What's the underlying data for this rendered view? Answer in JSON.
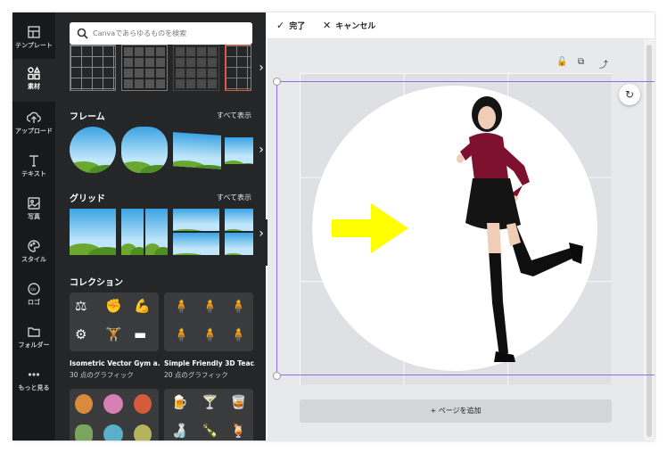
{
  "rail": {
    "items": [
      {
        "label": "テンプレート",
        "icon": "template-icon"
      },
      {
        "label": "素材",
        "icon": "elements-icon"
      },
      {
        "label": "アップロード",
        "icon": "upload-icon"
      },
      {
        "label": "テキスト",
        "icon": "text-icon"
      },
      {
        "label": "写真",
        "icon": "photo-icon"
      },
      {
        "label": "スタイル",
        "icon": "palette-icon"
      },
      {
        "label": "ロゴ",
        "icon": "logo-icon"
      },
      {
        "label": "フォルダー",
        "icon": "folder-icon"
      },
      {
        "label": "もっと見る",
        "icon": "more-icon"
      }
    ]
  },
  "search": {
    "placeholder": "Canvaであらゆるものを検索"
  },
  "frames": {
    "title": "フレーム",
    "see_all": "すべて表示"
  },
  "grids": {
    "title": "グリッド",
    "see_all": "すべて表示"
  },
  "collections": {
    "title": "コレクション",
    "items": [
      {
        "name": "Isometric Vector Gym a...",
        "count": "30 点のグラフィック"
      },
      {
        "name": "Simple Friendly 3D Teac...",
        "count": "20 点のグラフィック"
      }
    ]
  },
  "toolbar": {
    "done": "完了",
    "cancel": "キャンセル"
  },
  "canvas": {
    "add_page": "+ ページを追加"
  },
  "colors": {
    "selection": "#8b6fe8",
    "arrow": "#ffff00",
    "rail_bg": "#18191b",
    "panel_bg": "#252627"
  }
}
